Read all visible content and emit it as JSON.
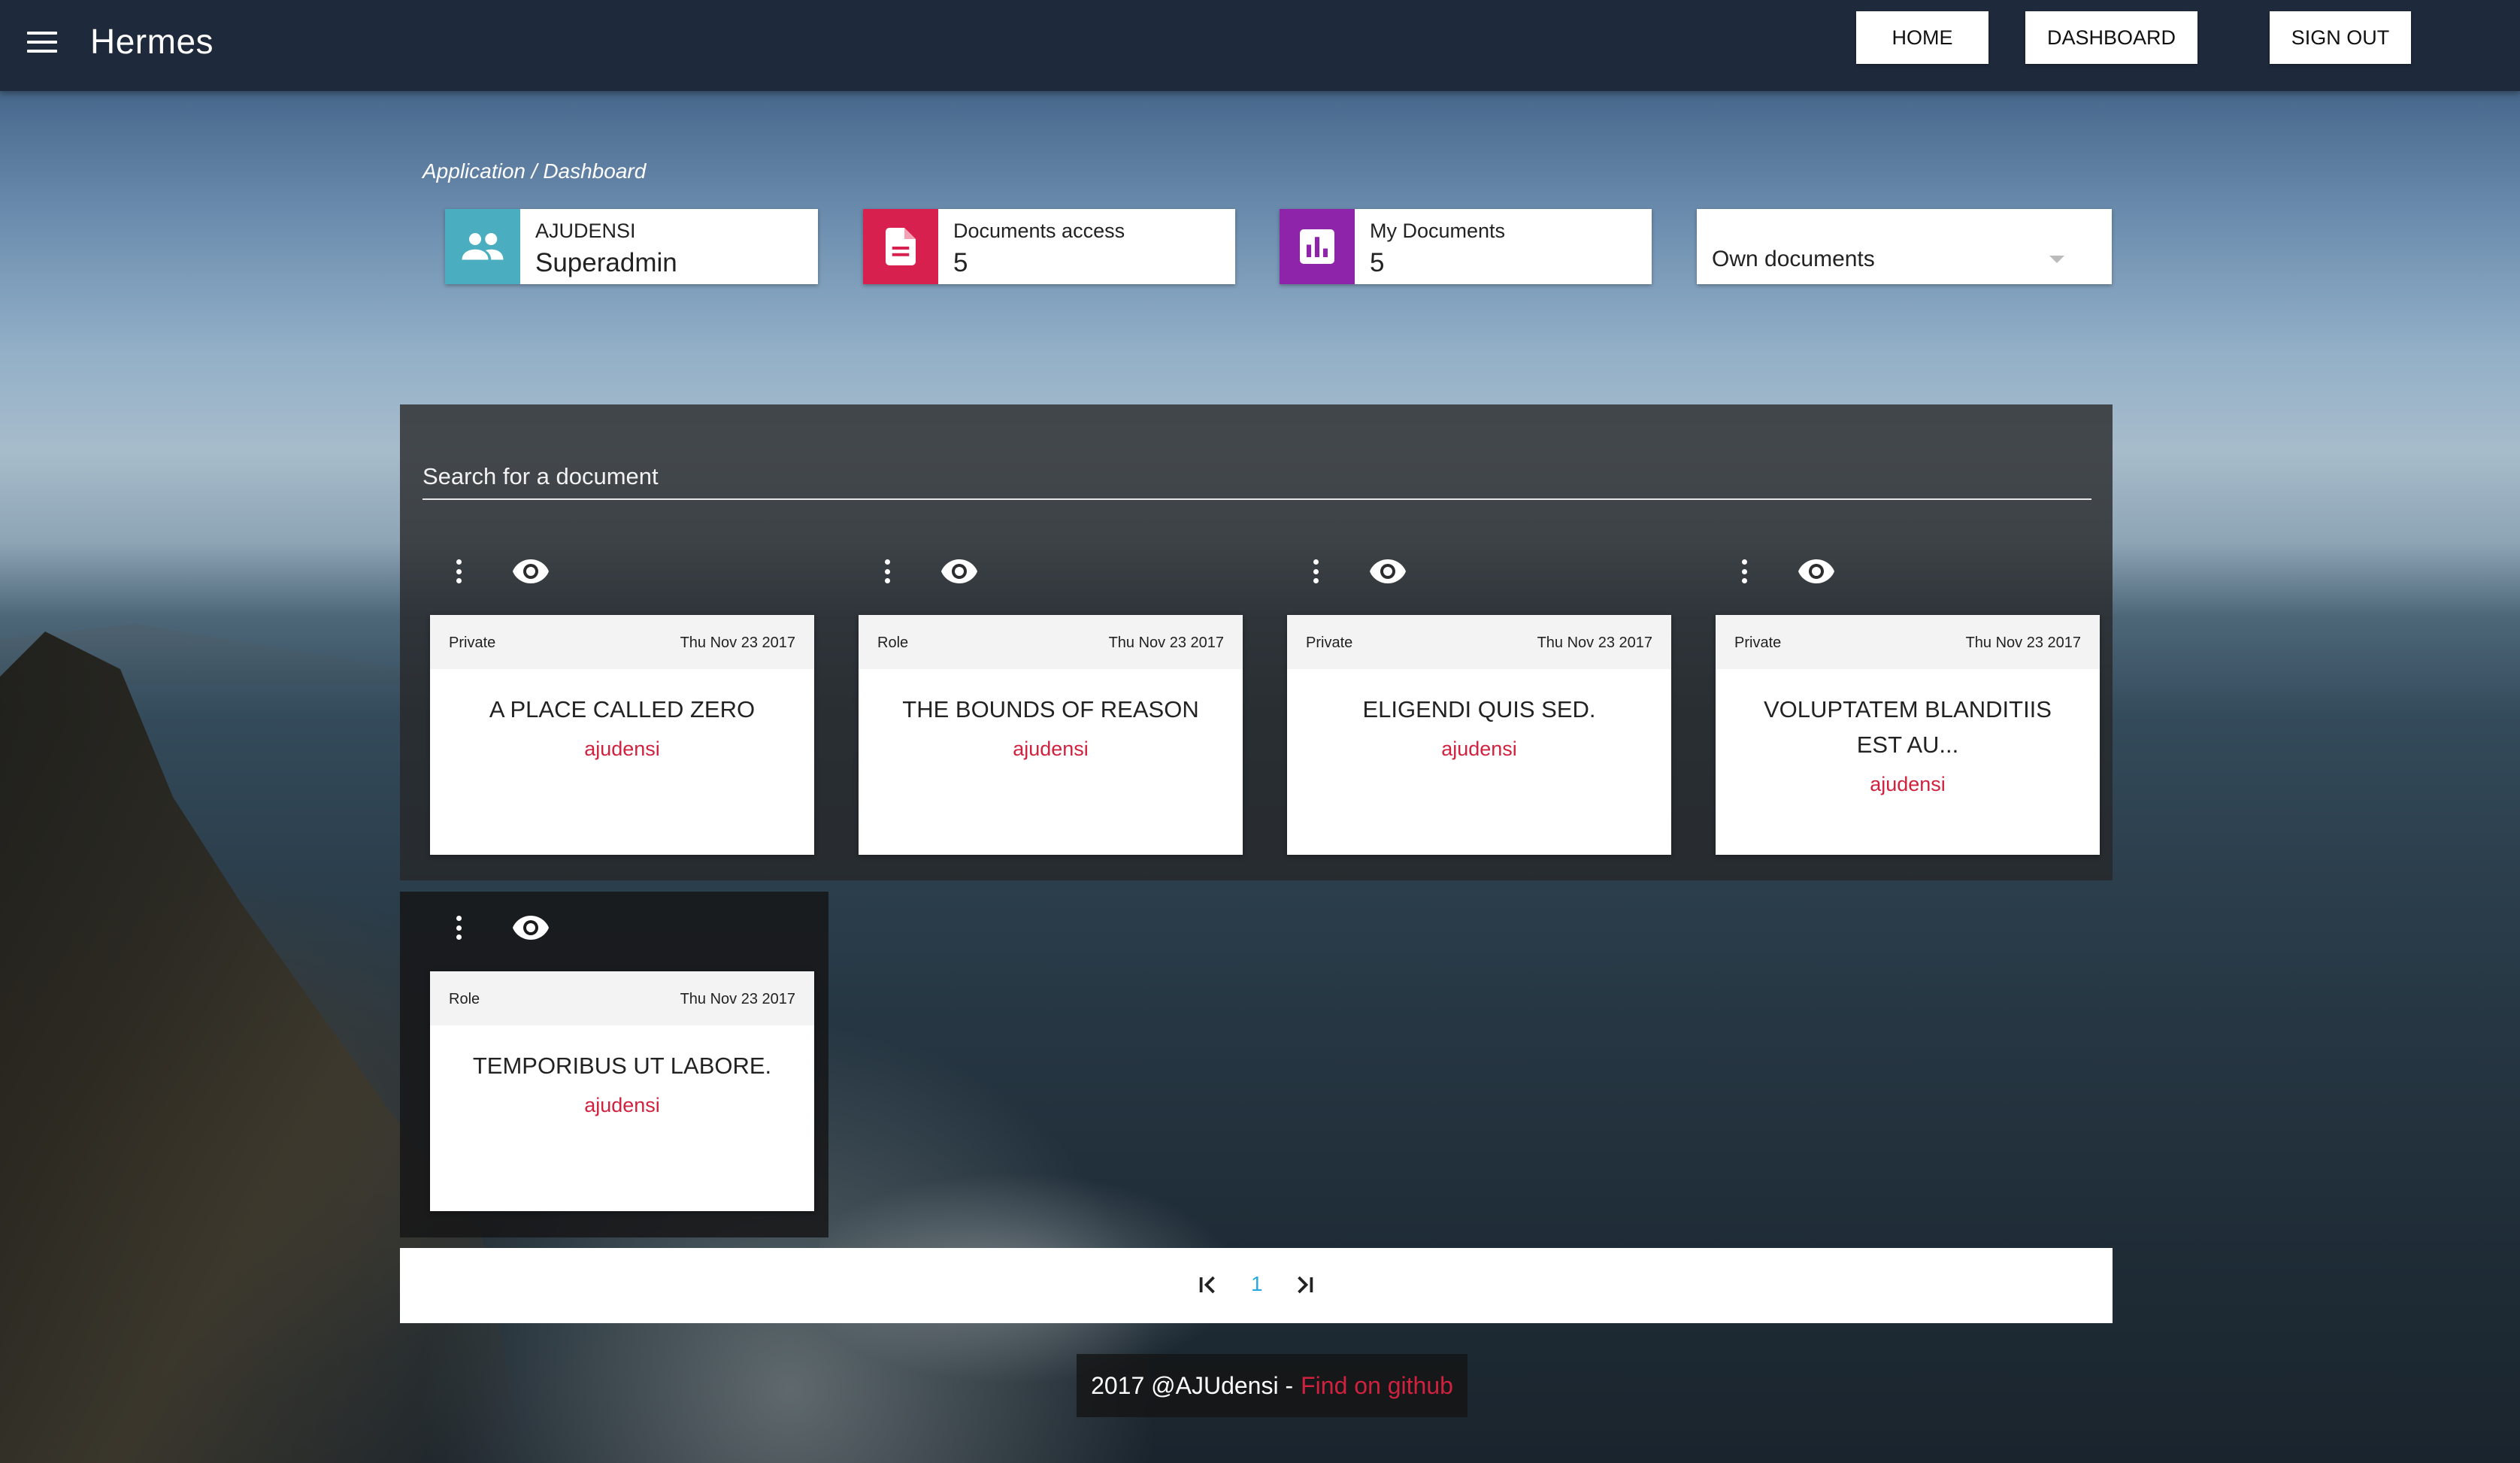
{
  "app": {
    "title": "Hermes"
  },
  "nav": {
    "home": "HOME",
    "dashboard": "DASHBOARD",
    "signout": "SIGN OUT"
  },
  "breadcrumb": "Application / Dashboard",
  "stats": [
    {
      "label": "AJUDENSI",
      "value": "Superadmin",
      "icon": "people-icon",
      "color": "#4aaec0"
    },
    {
      "label": "Documents access",
      "value": "5",
      "icon": "document-icon",
      "color": "#d8204f"
    },
    {
      "label": "My Documents",
      "value": "5",
      "icon": "bar-chart-icon",
      "color": "#8e24aa"
    }
  ],
  "filter": {
    "selected": "Own documents"
  },
  "search": {
    "placeholder": "Search for a document"
  },
  "documents": [
    {
      "access": "Private",
      "date": "Thu Nov 23 2017",
      "title": "A PLACE CALLED ZERO",
      "author": "ajudensi"
    },
    {
      "access": "Role",
      "date": "Thu Nov 23 2017",
      "title": "THE BOUNDS OF REASON",
      "author": "ajudensi"
    },
    {
      "access": "Private",
      "date": "Thu Nov 23 2017",
      "title": "ELIGENDI QUIS SED.",
      "author": "ajudensi"
    },
    {
      "access": "Private",
      "date": "Thu Nov 23 2017",
      "title": "VOLUPTATEM BLANDITIIS EST AU...",
      "author": "ajudensi"
    },
    {
      "access": "Role",
      "date": "Thu Nov 23 2017",
      "title": "TEMPORIBUS UT LABORE.",
      "author": "ajudensi"
    }
  ],
  "pagination": {
    "current": "1"
  },
  "footer": {
    "text": "2017 @AJUdensi -",
    "link": "Find on github"
  },
  "colors": {
    "accent": "#d0213f",
    "topbar": "#1e2a3c",
    "page_link": "#29a8e0"
  }
}
